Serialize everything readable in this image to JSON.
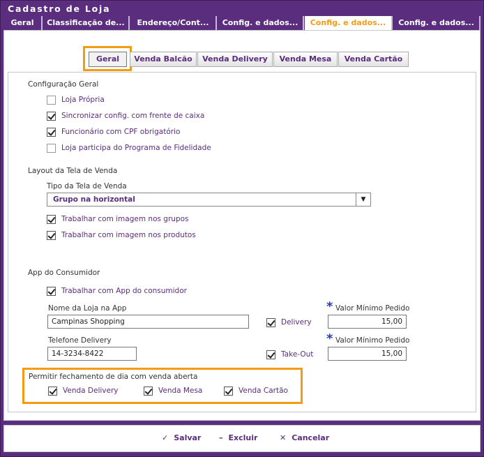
{
  "window": {
    "title": "Cadastro de Loja"
  },
  "tabs": [
    {
      "label": "Geral"
    },
    {
      "label": "Classificação de..."
    },
    {
      "label": "Endereço/Cont..."
    },
    {
      "label": "Config. e dados..."
    },
    {
      "label": "Config. e dados..."
    },
    {
      "label": "Config. e dados..."
    }
  ],
  "subtabs": [
    {
      "label": "Geral"
    },
    {
      "label": "Venda Balcão"
    },
    {
      "label": "Venda Delivery"
    },
    {
      "label": "Venda Mesa"
    },
    {
      "label": "Venda Cartão"
    }
  ],
  "config_geral": {
    "title": "Configuração Geral",
    "items": [
      {
        "label": "Loja Própria",
        "checked": false
      },
      {
        "label": "Sincronizar config. com frente de caixa",
        "checked": true
      },
      {
        "label": "Funcionário com CPF obrigatório",
        "checked": true
      },
      {
        "label": "Loja participa do Programa de Fidelidade",
        "checked": false
      }
    ]
  },
  "layout": {
    "title": "Layout da Tela de Venda",
    "tipo_label": "Tipo da Tela de Venda",
    "tipo_value": "Grupo na horizontal",
    "items": [
      {
        "label": "Trabalhar com imagem nos grupos",
        "checked": true
      },
      {
        "label": "Trabalhar com imagem nos produtos",
        "checked": true
      }
    ]
  },
  "app": {
    "title": "App do Consumidor",
    "use_app_label": "Trabalhar com App do consumidor",
    "nome_label": "Nome da Loja na App",
    "nome_value": "Campinas Shopping",
    "delivery_label": "Delivery",
    "valor_min_label": "Valor Mínimo Pedido",
    "valor_min_delivery": "15,00",
    "telefone_label": "Telefone Delivery",
    "telefone_value": "14-3234-8422",
    "takeout_label": "Take-Out",
    "valor_min_takeout": "15,00"
  },
  "fechamento": {
    "title": "Permitir fechamento de dia com venda aberta",
    "items": [
      {
        "label": "Venda Delivery",
        "checked": true
      },
      {
        "label": "Venda Mesa",
        "checked": true
      },
      {
        "label": "Venda Cartão",
        "checked": true
      }
    ]
  },
  "footer": {
    "save_label": "Salvar",
    "delete_label": "Excluir",
    "cancel_label": "Cancelar"
  },
  "colors": {
    "brand": "#5b2d7e",
    "accent": "#f39c12",
    "link": "#2c3e9e"
  }
}
